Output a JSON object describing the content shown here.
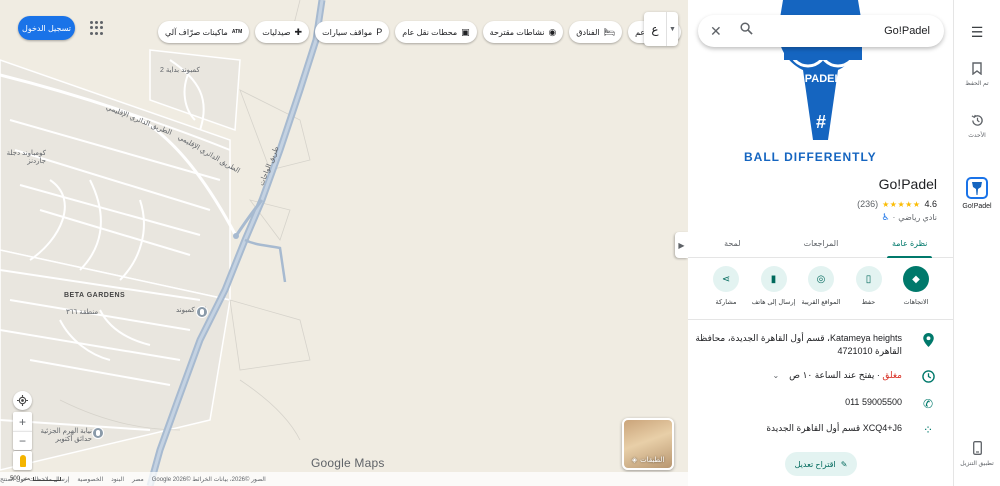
{
  "map": {
    "sign_in": "تسجيل الدخول",
    "chips": [
      {
        "icon": "restaurant-icon",
        "glyph": "🍴",
        "label": "مطاعم"
      },
      {
        "icon": "hotel-icon",
        "glyph": "🛏",
        "label": "الفنادق"
      },
      {
        "icon": "camera-icon",
        "glyph": "◉",
        "label": "نشاطات مقترحة"
      },
      {
        "icon": "transit-icon",
        "glyph": "▣",
        "label": "محطات نقل عام"
      },
      {
        "icon": "parking-icon",
        "glyph": "P",
        "label": "مواقف سيارات"
      },
      {
        "icon": "pharmacy-icon",
        "glyph": "✚",
        "label": "صيدليات"
      },
      {
        "icon": "atm-icon",
        "glyph": "ATM",
        "label": "ماكينات صرّاف آلي"
      }
    ],
    "lang_char": "ع",
    "labels": {
      "compound_bedaya": "كمبوند بداية 2",
      "compound_deja": "كومباوند دجلة جاردنز",
      "beta_gardens": "BETA GARDENS",
      "zone_366": "منطقة ٣٦٦",
      "compound_kenz": "كنز كمبوند",
      "pyramid_school": "نيابة الهرم الجزئية حدائق أكتوبر",
      "road_regional_1": "الطريق الدائري الإقليمي",
      "road_regional_2": "الطريق الدائري الإقليمي",
      "road_main": "طريق الواحات"
    },
    "layers_label": "الطبقات",
    "google_logo": "Google Maps",
    "attribution": [
      "الصور ©2026، بيانات الخرائط ©2026 Google",
      "مصر",
      "البنود",
      "الخصوصية",
      "إرسال ملاحظات حول المنتج"
    ],
    "scale": "500 متر"
  },
  "panel": {
    "search_value": "Go!Padel",
    "hero_logo_text": "PADEL",
    "hero_logo_mark": "#",
    "hero_caption": "BALL DIFFERENTLY",
    "title": "Go!Padel",
    "rating": "4.6",
    "stars": "★★★★★",
    "reviews": "(236)",
    "category": "نادي رياضي",
    "tabs": [
      {
        "id": "overview",
        "label": "نظرة عامة",
        "active": true
      },
      {
        "id": "reviews",
        "label": "المراجعات",
        "active": false
      },
      {
        "id": "about",
        "label": "لمحة",
        "active": false
      }
    ],
    "actions": [
      {
        "id": "directions",
        "icon": "directions-icon",
        "glyph": "◆",
        "label": "الاتجاهات"
      },
      {
        "id": "save",
        "icon": "bookmark-icon",
        "glyph": "▯",
        "label": "حفظ"
      },
      {
        "id": "nearby",
        "icon": "nearby-icon",
        "glyph": "◎",
        "label": "المواقع القريبة"
      },
      {
        "id": "send",
        "icon": "phone-send-icon",
        "glyph": "▮",
        "label": "إرسال إلى هاتف"
      },
      {
        "id": "share",
        "icon": "share-icon",
        "glyph": "⋖",
        "label": "مشاركة"
      }
    ],
    "address": "Katameya heights، قسم أول القاهرة الجديدة، محافظة القاهرة 4721010",
    "hours_status": "مغلق",
    "hours_detail": " · يفتح عند الساعة ١٠ ص",
    "phone": "011 59005500",
    "plus_code": "XCQ4+J6 قسم أول القاهرة الجديدة",
    "suggest_edit": "اقتراح تعديل"
  },
  "rail": {
    "saved": "تم الحفظ",
    "recent": "الأحدث",
    "current": "Go!Padel",
    "get_app": "تطبيق التنزيل"
  },
  "colors": {
    "accent": "#00796b",
    "primary_blue": "#1a73e8",
    "star": "#fbbc04",
    "closed": "#d93025"
  }
}
